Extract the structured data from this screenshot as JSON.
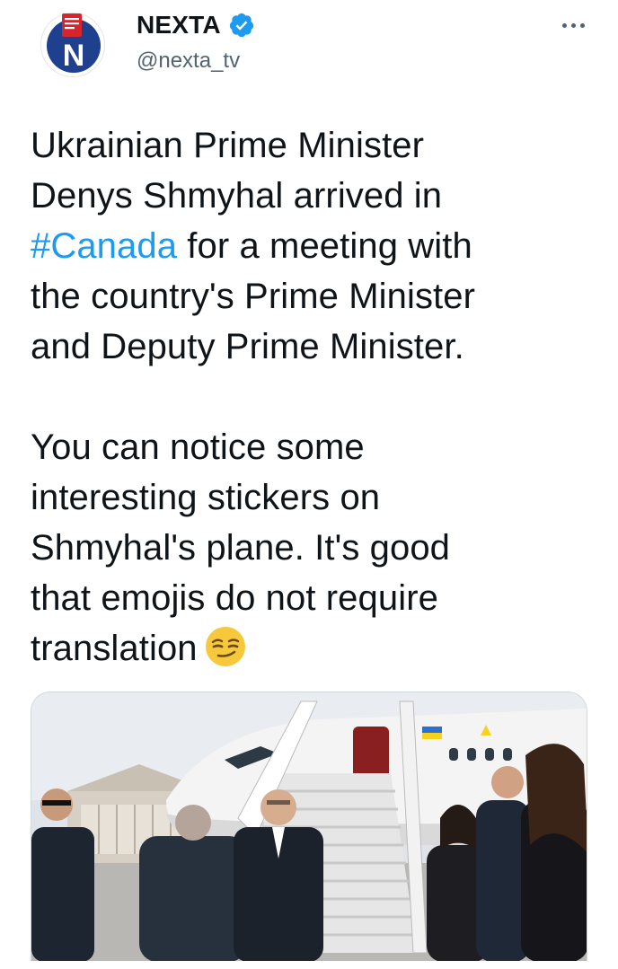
{
  "account": {
    "name": "NEXTA",
    "handle": "@nexta_tv",
    "logo_letter": "N",
    "verified": true
  },
  "tweet": {
    "text_before_hashtag": "Ukrainian Prime Minister\nDenys Shmyhal arrived in\n",
    "hashtag": "#Canada",
    "text_after_hashtag": " for a meeting with\nthe country's Prime Minister\nand Deputy Prime Minister.",
    "paragraph2": "You can notice some\ninteresting stickers on\nShmyhal's plane. It's good\nthat emojis do not require\ntranslation",
    "emoji": "smirking-face"
  },
  "media": {
    "type": "photo",
    "subject": "Officials greeting at the airplane stairs"
  },
  "colors": {
    "link": "#1d9bf0",
    "verified": "#1d9bf0",
    "text": "#0f1419",
    "secondary": "#536471",
    "logo_red": "#d6252c",
    "logo_blue": "#1f3f8f"
  },
  "icons": {
    "verified": "verified-badge-icon",
    "more": "more-options-icon"
  }
}
